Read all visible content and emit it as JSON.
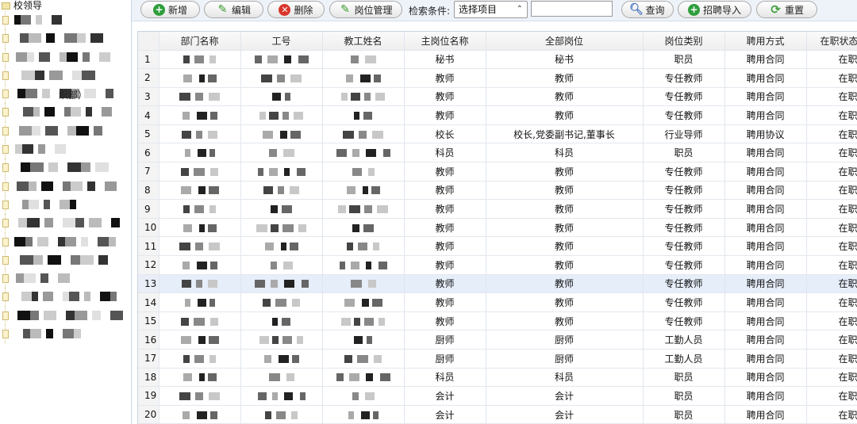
{
  "tree": {
    "root_label": "校领导",
    "items": [
      {
        "visible_text": ""
      },
      {
        "visible_text": ""
      },
      {
        "visible_text": ""
      },
      {
        "visible_text": ""
      },
      {
        "visible_text": "织部）"
      },
      {
        "visible_text": ""
      },
      {
        "visible_text": ""
      },
      {
        "visible_text": ""
      },
      {
        "visible_text": ""
      },
      {
        "visible_text": ""
      },
      {
        "visible_text": ""
      },
      {
        "visible_text": ""
      },
      {
        "visible_text": ""
      },
      {
        "visible_text": ""
      },
      {
        "visible_text": ""
      },
      {
        "visible_text": ""
      },
      {
        "visible_text": ""
      },
      {
        "visible_text": ""
      }
    ]
  },
  "toolbar": {
    "add_label": "新增",
    "edit_label": "编辑",
    "delete_label": "删除",
    "position_label": "岗位管理",
    "search_condition_label": "检索条件:",
    "select_value": "选择项目",
    "search_input_value": "",
    "query_label": "查询",
    "import_label": "招聘导入",
    "reset_label": "重置"
  },
  "table": {
    "columns": [
      "部门名称",
      "工号",
      "教工姓名",
      "主岗位名称",
      "全部岗位",
      "岗位类别",
      "聘用方式",
      "在职状态"
    ],
    "selected_row": 13,
    "rows": [
      {
        "n": "1",
        "main": "秘书",
        "all": "秘书",
        "cat": "职员",
        "hire": "聘用合同",
        "status": "在职"
      },
      {
        "n": "2",
        "main": "教师",
        "all": "教师",
        "cat": "专任教师",
        "hire": "聘用合同",
        "status": "在职"
      },
      {
        "n": "3",
        "main": "教师",
        "all": "教师",
        "cat": "专任教师",
        "hire": "聘用合同",
        "status": "在职"
      },
      {
        "n": "4",
        "main": "教师",
        "all": "教师",
        "cat": "专任教师",
        "hire": "聘用合同",
        "status": "在职"
      },
      {
        "n": "5",
        "main": "校长",
        "all": "校长,党委副书记,董事长",
        "cat": "行业导师",
        "hire": "聘用协议",
        "status": "在职"
      },
      {
        "n": "6",
        "main": "科员",
        "all": "科员",
        "cat": "职员",
        "hire": "聘用合同",
        "status": "在职"
      },
      {
        "n": "7",
        "main": "教师",
        "all": "教师",
        "cat": "专任教师",
        "hire": "聘用合同",
        "status": "在职"
      },
      {
        "n": "8",
        "main": "教师",
        "all": "教师",
        "cat": "专任教师",
        "hire": "聘用合同",
        "status": "在职"
      },
      {
        "n": "9",
        "main": "教师",
        "all": "教师",
        "cat": "专任教师",
        "hire": "聘用合同",
        "status": "在职"
      },
      {
        "n": "10",
        "main": "教师",
        "all": "教师",
        "cat": "专任教师",
        "hire": "聘用合同",
        "status": "在职"
      },
      {
        "n": "11",
        "main": "教师",
        "all": "教师",
        "cat": "专任教师",
        "hire": "聘用合同",
        "status": "在职"
      },
      {
        "n": "12",
        "main": "教师",
        "all": "教师",
        "cat": "专任教师",
        "hire": "聘用合同",
        "status": "在职"
      },
      {
        "n": "13",
        "main": "教师",
        "all": "教师",
        "cat": "专任教师",
        "hire": "聘用合同",
        "status": "在职"
      },
      {
        "n": "14",
        "main": "教师",
        "all": "教师",
        "cat": "专任教师",
        "hire": "聘用合同",
        "status": "在职"
      },
      {
        "n": "15",
        "main": "教师",
        "all": "教师",
        "cat": "专任教师",
        "hire": "聘用合同",
        "status": "在职"
      },
      {
        "n": "16",
        "main": "厨师",
        "all": "厨师",
        "cat": "工勤人员",
        "hire": "聘用合同",
        "status": "在职"
      },
      {
        "n": "17",
        "main": "厨师",
        "all": "厨师",
        "cat": "工勤人员",
        "hire": "聘用合同",
        "status": "在职"
      },
      {
        "n": "18",
        "main": "科员",
        "all": "科员",
        "cat": "职员",
        "hire": "聘用合同",
        "status": "在职"
      },
      {
        "n": "19",
        "main": "会计",
        "all": "会计",
        "cat": "职员",
        "hire": "聘用合同",
        "status": "在职"
      },
      {
        "n": "20",
        "main": "会计",
        "all": "会计",
        "cat": "职员",
        "hire": "聘用合同",
        "status": "在职"
      }
    ]
  },
  "colors": {
    "toolbar_bg": "#eef3f9",
    "selected_row": "#e6eefa",
    "add_icon": "#2e9e3c",
    "delete_icon": "#d9362b"
  }
}
